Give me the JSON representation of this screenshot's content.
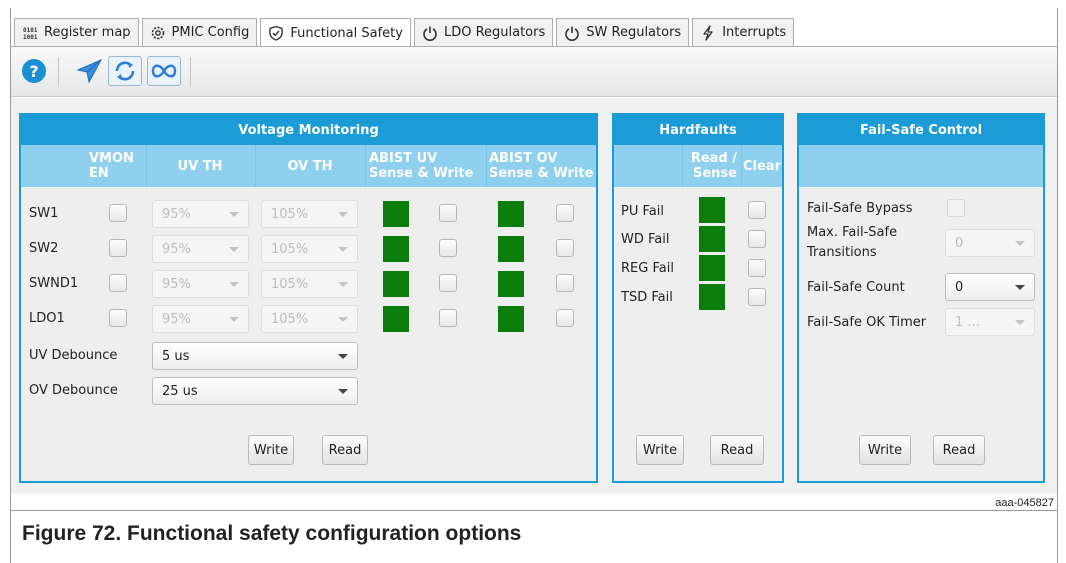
{
  "tabs": [
    {
      "label": "Register map",
      "icon": "binary-icon"
    },
    {
      "label": "PMIC Config",
      "icon": "gear-icon"
    },
    {
      "label": "Functional Safety",
      "icon": "shield-check-icon",
      "active": true
    },
    {
      "label": "LDO Regulators",
      "icon": "power-icon"
    },
    {
      "label": "SW Regulators",
      "icon": "power-icon"
    },
    {
      "label": "Interrupts",
      "icon": "lightning-icon"
    }
  ],
  "toolbar": {
    "help": "help-icon",
    "send": "send-icon",
    "refresh": "refresh-icon",
    "loop": "infinity-icon"
  },
  "voltage_monitoring": {
    "title": "Voltage Monitoring",
    "headers": {
      "vmon_en_1": "VMON",
      "vmon_en_2": "EN",
      "uv_th": "UV TH",
      "ov_th": "OV TH",
      "abist_uv_1": "ABIST UV",
      "abist_uv_2": "Sense & Write",
      "abist_ov_1": "ABIST OV",
      "abist_ov_2": "Sense & Write"
    },
    "rows": [
      {
        "name": "SW1",
        "uv": "95%",
        "ov": "105%"
      },
      {
        "name": "SW2",
        "uv": "95%",
        "ov": "105%"
      },
      {
        "name": "SWND1",
        "uv": "95%",
        "ov": "105%"
      },
      {
        "name": "LDO1",
        "uv": "95%",
        "ov": "105%"
      }
    ],
    "uv_debounce_label": "UV Debounce",
    "uv_debounce_value": "5 us",
    "ov_debounce_label": "OV Debounce",
    "ov_debounce_value": "25 us",
    "write": "Write",
    "read": "Read",
    "led_color": "#0a7d0a"
  },
  "hardfaults": {
    "title": "Hardfaults",
    "header_read_1": "Read /",
    "header_read_2": "Sense",
    "header_clear": "Clear",
    "rows": [
      "PU Fail",
      "WD Fail",
      "REG Fail",
      "TSD Fail"
    ],
    "write": "Write",
    "read": "Read"
  },
  "failsafe": {
    "title": "Fail-Safe Control",
    "bypass_label": "Fail-Safe Bypass",
    "max_transitions_label_1": "Max. Fail-Safe",
    "max_transitions_label_2": "Transitions",
    "max_transitions_value": "0",
    "count_label": "Fail-Safe Count",
    "count_value": "0",
    "ok_timer_label": "Fail-Safe OK Timer",
    "ok_timer_value": "1 ...",
    "write": "Write",
    "read": "Read"
  },
  "accent_color": "#1b9cd6",
  "header_color": "#8ed0ee",
  "figure_id": "aaa-045827",
  "caption": "Figure 72.  Functional safety configuration options"
}
